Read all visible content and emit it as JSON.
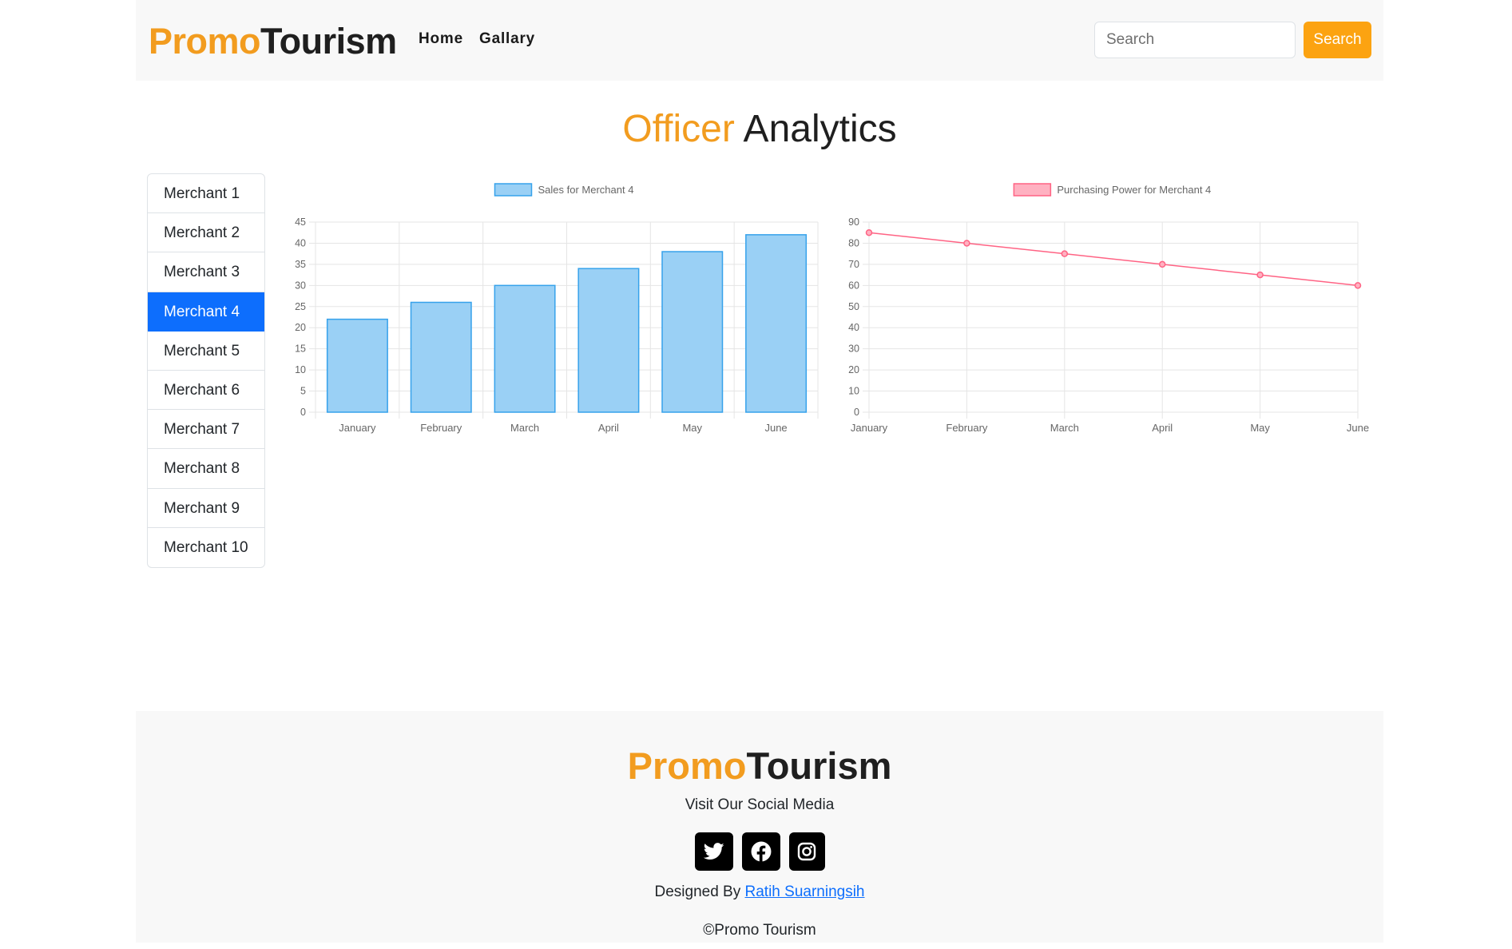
{
  "header": {
    "brand_part1": "Promo",
    "brand_part2": "Tourism",
    "nav": [
      "Home",
      "Gallary"
    ],
    "search_placeholder": "Search",
    "search_button": "Search"
  },
  "page": {
    "title_part1": "Officer",
    "title_part2": "Analytics"
  },
  "sidebar": {
    "items": [
      "Merchant 1",
      "Merchant 2",
      "Merchant 3",
      "Merchant 4",
      "Merchant 5",
      "Merchant 6",
      "Merchant 7",
      "Merchant 8",
      "Merchant 9",
      "Merchant 10"
    ],
    "active_index": 3
  },
  "chart_data": [
    {
      "type": "bar",
      "categories": [
        "January",
        "February",
        "March",
        "April",
        "May",
        "June"
      ],
      "series": [
        {
          "name": "Sales for Merchant 4",
          "values": [
            22,
            26,
            30,
            34,
            38,
            42
          ]
        }
      ],
      "ylim": [
        0,
        45
      ],
      "yticks": [
        0,
        5,
        10,
        15,
        20,
        25,
        30,
        35,
        40,
        45
      ],
      "grid": true,
      "legend": "top-center",
      "colors": {
        "fill": "#9ad0f5",
        "stroke": "#36a2eb"
      }
    },
    {
      "type": "line",
      "categories": [
        "January",
        "February",
        "March",
        "April",
        "May",
        "June"
      ],
      "series": [
        {
          "name": "Purchasing Power for Merchant 4",
          "values": [
            85,
            80,
            75,
            70,
            65,
            60
          ]
        }
      ],
      "ylim": [
        0,
        90
      ],
      "yticks": [
        0,
        10,
        20,
        30,
        40,
        50,
        60,
        70,
        80,
        90
      ],
      "grid": true,
      "legend": "top-center",
      "colors": {
        "fill": "#ffb1c1",
        "stroke": "#ff6384"
      }
    }
  ],
  "footer": {
    "brand_part1": "Promo",
    "brand_part2": "Tourism",
    "social_label": "Visit Our Social Media",
    "socials": [
      "twitter-icon",
      "facebook-icon",
      "instagram-icon"
    ],
    "designed_prefix": "Designed By",
    "designer": "Ratih Suarningsih",
    "copyright": "©Promo Tourism"
  },
  "colors": {
    "accent": "#f29c1f",
    "search_button": "#fca311",
    "active": "#0d6efd",
    "surface": "#f8f8f8"
  }
}
